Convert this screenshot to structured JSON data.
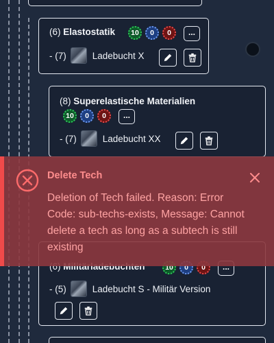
{
  "tree": {
    "cards": [
      {
        "id": "elastostatik",
        "number": "(6)",
        "name": "Elastostatik",
        "badges": {
          "green": "10",
          "blue": "0",
          "red": "0"
        },
        "more_label": "...",
        "subtech": {
          "prefix": "- (7)",
          "name": "Ladebucht X"
        }
      },
      {
        "id": "superelastische",
        "number": "(8)",
        "name": "Superelastische Materialien",
        "badges": {
          "green": "10",
          "blue": "0",
          "red": "0"
        },
        "more_label": "...",
        "subtech": {
          "prefix": "- (7)",
          "name": "Ladebucht XX"
        }
      },
      {
        "id": "militaerladebuchten",
        "number": "(6)",
        "name": "Militärladebuchten",
        "badges": {
          "green": "10",
          "blue": "0",
          "red": "0"
        },
        "more_label": "...",
        "subtech": {
          "prefix": "- (5)",
          "name": "Ladebucht S - Militär Version"
        }
      }
    ]
  },
  "toast": {
    "title": "Delete Tech",
    "message": "Deletion of Tech failed. Reason: Error Code: sub-techs-exists, Message: Cannot delete a tech as long as a subtech is still existing",
    "icon": "error-circle-x-icon",
    "close_icon": "close-icon",
    "accent_color": "#ef4a4a",
    "background_color": "#8c373e"
  },
  "icons": {
    "edit": "pencil-icon",
    "delete": "trash-icon"
  }
}
